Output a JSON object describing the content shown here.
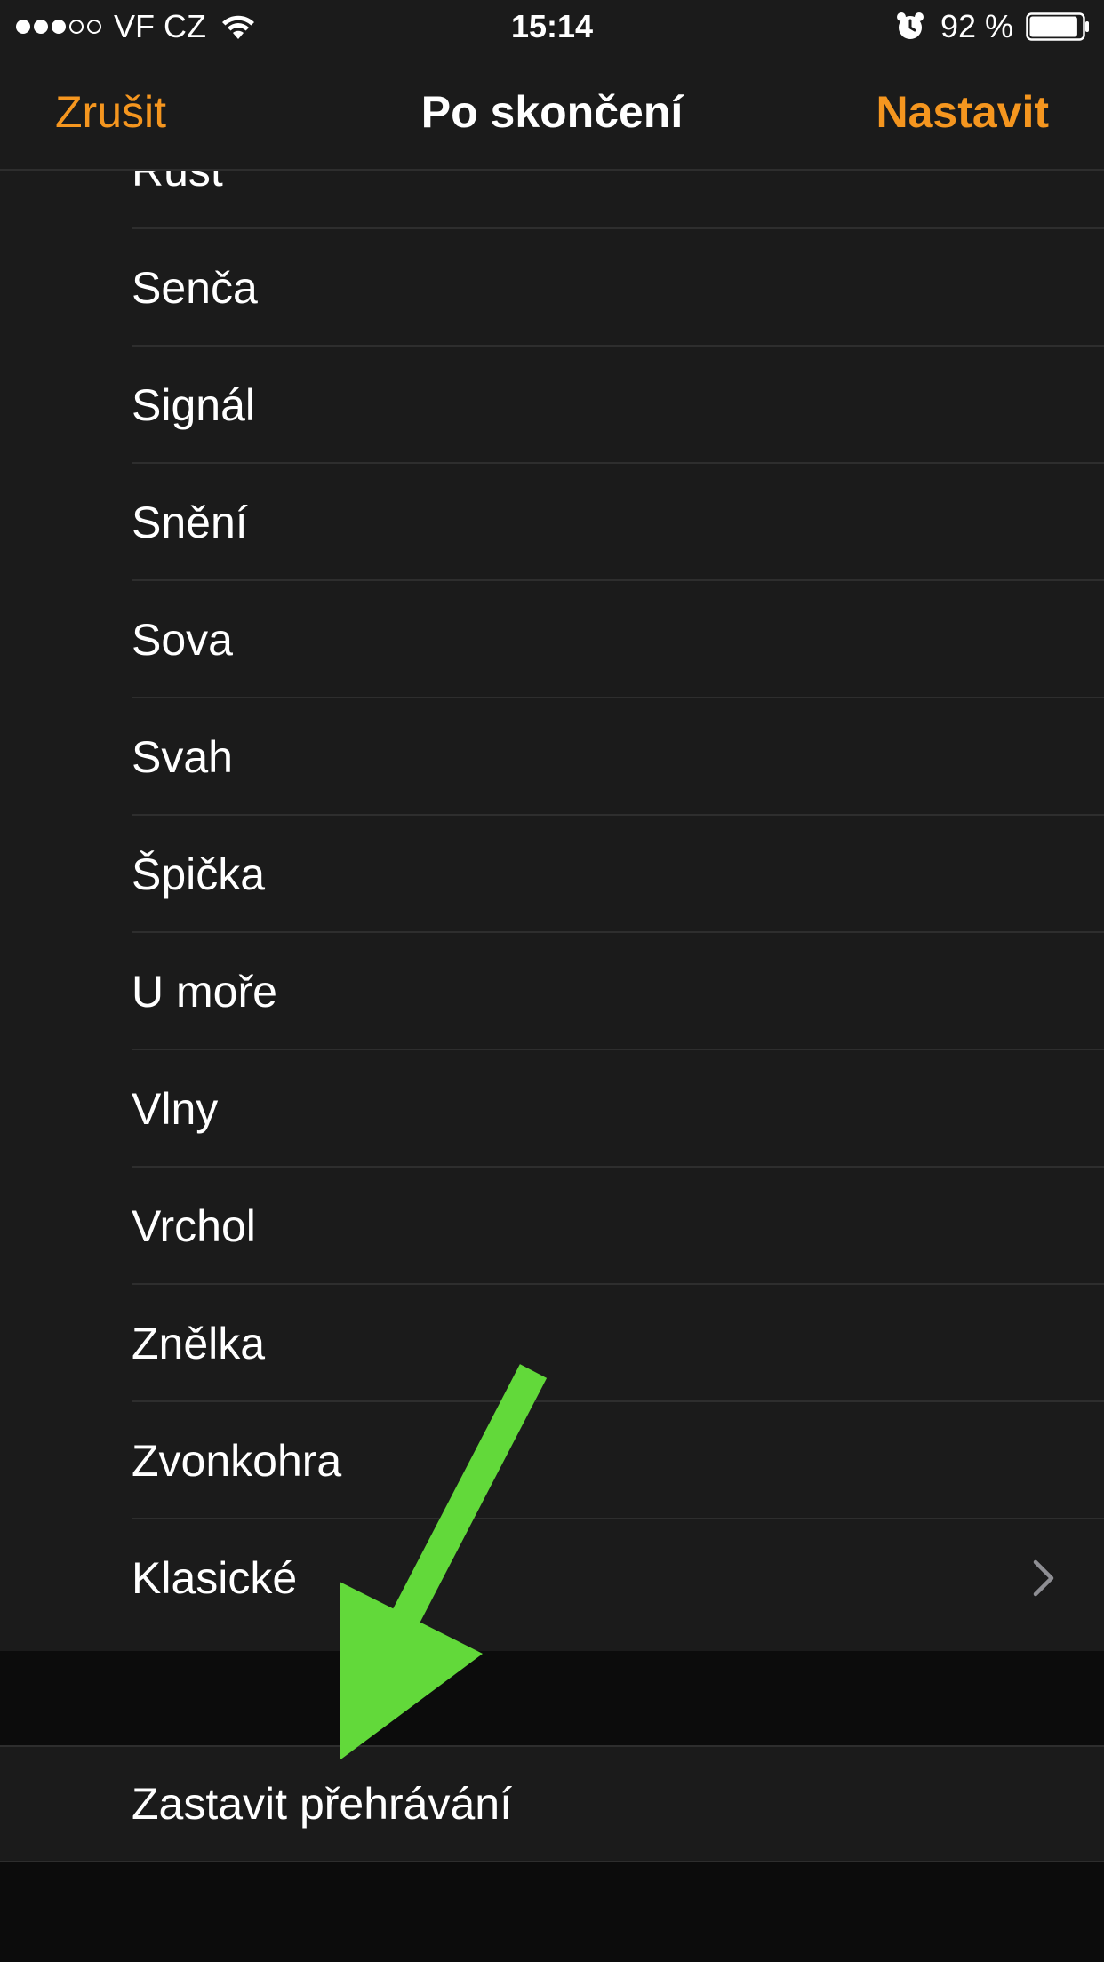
{
  "status_bar": {
    "carrier": "VF CZ",
    "signal_bars_filled": 3,
    "signal_bars_total": 5,
    "time": "15:14",
    "battery_percent": "92 %",
    "battery_level": 0.92
  },
  "nav": {
    "cancel_label": "Zrušit",
    "title": "Po skončení",
    "set_label": "Nastavit",
    "accent_color": "#f5961f"
  },
  "tones": {
    "items": [
      {
        "label": "Růst"
      },
      {
        "label": "Senča"
      },
      {
        "label": "Signál"
      },
      {
        "label": "Snění"
      },
      {
        "label": "Sova"
      },
      {
        "label": "Svah"
      },
      {
        "label": "Špička"
      },
      {
        "label": "U moře"
      },
      {
        "label": "Vlny"
      },
      {
        "label": "Vrchol"
      },
      {
        "label": "Znělka"
      },
      {
        "label": "Zvonkohra"
      },
      {
        "label": "Klasické"
      }
    ]
  },
  "stop_playing": {
    "label": "Zastavit přehrávání"
  },
  "annotation": {
    "arrow_color": "#62d93a",
    "icon": "arrow-down-left-icon"
  }
}
